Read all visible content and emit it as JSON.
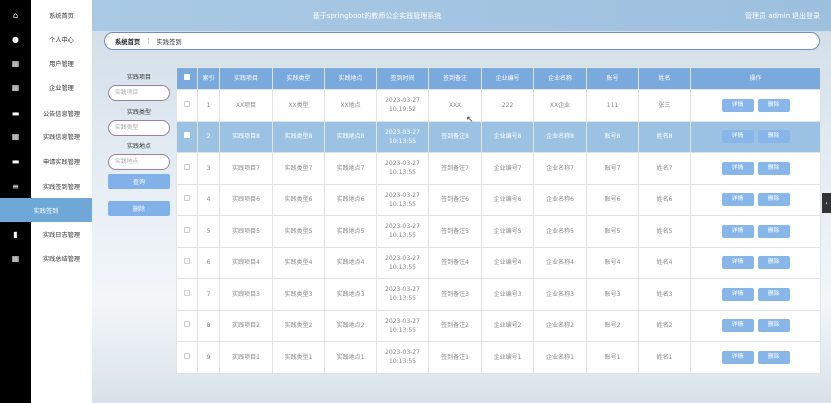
{
  "header": {
    "title": "基于springboot的教师公企实践管理系统",
    "user": "管理员 admin",
    "logout": "退出登录"
  },
  "menu": [
    {
      "label": "系统首页",
      "icon": "home-icon",
      "glyph": "⌂"
    },
    {
      "label": "个人中心",
      "icon": "user-icon",
      "glyph": "●"
    },
    {
      "label": "用户管理",
      "icon": "grid-icon",
      "glyph": "▦"
    },
    {
      "label": "企业管理",
      "icon": "grid-icon",
      "glyph": "▦"
    },
    {
      "label": "公告信息管理",
      "icon": "monitor-icon",
      "glyph": "▬"
    },
    {
      "label": "实践信息管理",
      "icon": "grid-icon",
      "glyph": "▦"
    },
    {
      "label": "申请实践管理",
      "icon": "ticket-icon",
      "glyph": "▬"
    },
    {
      "label": "实践签到管理",
      "icon": "list-icon",
      "glyph": "≡"
    },
    {
      "label": "实践签到",
      "icon": "",
      "glyph": ""
    },
    {
      "label": "实践日志管理",
      "icon": "chart-icon",
      "glyph": "▮"
    },
    {
      "label": "实践总结管理",
      "icon": "grid-icon",
      "glyph": "▦"
    }
  ],
  "breadcrumb": {
    "home": "系统首页",
    "sep": "⋮",
    "current": "实践签到"
  },
  "filters": {
    "project_label": "实践项目",
    "project_placeholder": "实践项目",
    "type_label": "实践类型",
    "type_placeholder": "实践类型",
    "place_label": "实践地点",
    "place_placeholder": "实践地点",
    "search_button": "查询",
    "delete_button": "删除"
  },
  "table": {
    "headers": [
      "索引",
      "实践项目",
      "实践类型",
      "实践地点",
      "签到时间",
      "签到备注",
      "企业编号",
      "企业名称",
      "账号",
      "姓名",
      "操作"
    ],
    "detail_label": "详情",
    "delete_label": "删除",
    "rows": [
      [
        "1",
        "XX项目",
        "XX类型",
        "XX地点",
        "2023-03-27 10:19:52",
        "XXX",
        "222",
        "XX企业",
        "111",
        "张三"
      ],
      [
        "2",
        "实践项目8",
        "实践类型8",
        "实践地点8",
        "2023-03-27 10:13:55",
        "签到备注8",
        "企业编号8",
        "企业名称8",
        "账号8",
        "姓名8"
      ],
      [
        "3",
        "实践项目7",
        "实践类型7",
        "实践地点7",
        "2023-03-27 10:13:55",
        "签到备注7",
        "企业编号7",
        "企业名称7",
        "账号7",
        "姓名7"
      ],
      [
        "4",
        "实践项目6",
        "实践类型6",
        "实践地点6",
        "2023-03-27 10:13:55",
        "签到备注6",
        "企业编号6",
        "企业名称6",
        "账号6",
        "姓名6"
      ],
      [
        "5",
        "实践项目5",
        "实践类型5",
        "实践地点5",
        "2023-03-27 10:13:55",
        "签到备注5",
        "企业编号5",
        "企业名称5",
        "账号5",
        "姓名5"
      ],
      [
        "6",
        "实践项目4",
        "实践类型4",
        "实践地点4",
        "2023-03-27 10:13:55",
        "签到备注4",
        "企业编号4",
        "企业名称4",
        "账号4",
        "姓名4"
      ],
      [
        "7",
        "实践项目3",
        "实践类型3",
        "实践地点3",
        "2023-03-27 10:13:55",
        "签到备注3",
        "企业编号3",
        "企业名称3",
        "账号3",
        "姓名3"
      ],
      [
        "8",
        "实践项目2",
        "实践类型2",
        "实践地点2",
        "2023-03-27 10:13:55",
        "签到备注2",
        "企业编号2",
        "企业名称2",
        "账号2",
        "姓名2"
      ],
      [
        "9",
        "实践项目1",
        "实践类型1",
        "实践地点1",
        "2023-03-27 10:13:55",
        "签到备注1",
        "企业编号1",
        "企业名称1",
        "账号1",
        "姓名1"
      ]
    ]
  },
  "colors": {
    "accent": "#7aa9dd",
    "selected_row": "#9cc2e3",
    "button": "#88b6e8"
  }
}
